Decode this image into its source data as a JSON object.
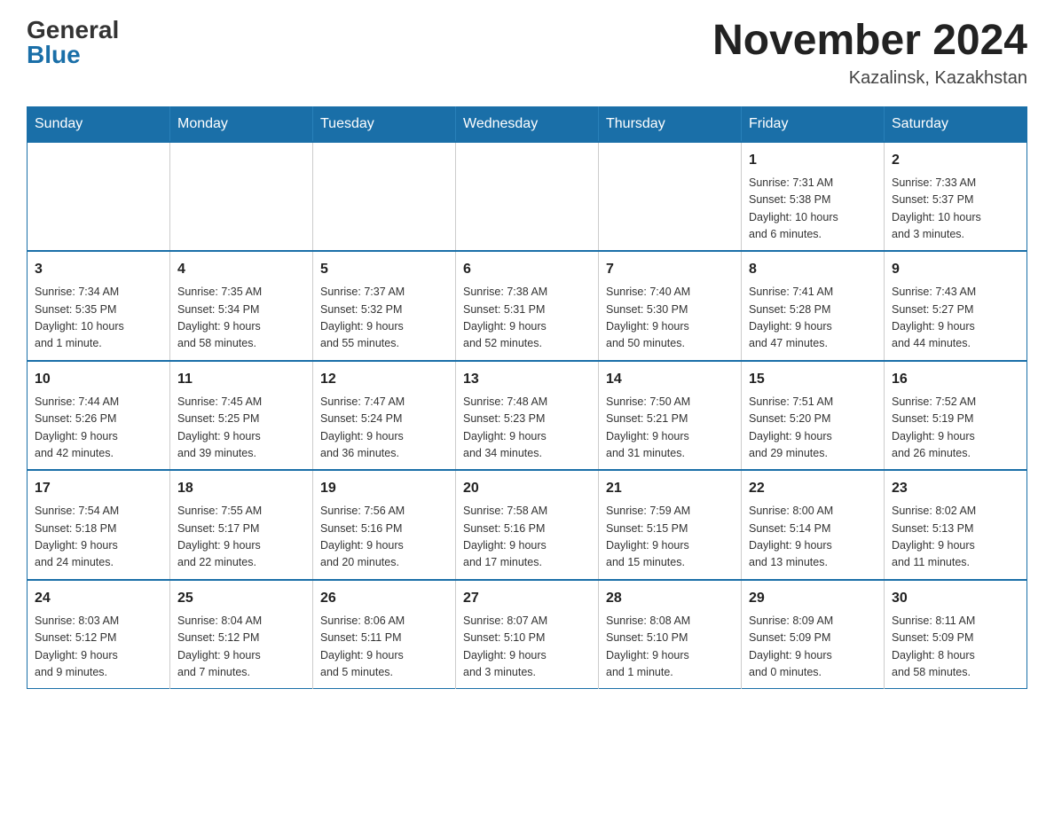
{
  "header": {
    "logo_general": "General",
    "logo_blue": "Blue",
    "month_title": "November 2024",
    "location": "Kazalinsk, Kazakhstan"
  },
  "weekdays": [
    "Sunday",
    "Monday",
    "Tuesday",
    "Wednesday",
    "Thursday",
    "Friday",
    "Saturday"
  ],
  "weeks": [
    [
      {
        "day": "",
        "info": ""
      },
      {
        "day": "",
        "info": ""
      },
      {
        "day": "",
        "info": ""
      },
      {
        "day": "",
        "info": ""
      },
      {
        "day": "",
        "info": ""
      },
      {
        "day": "1",
        "info": "Sunrise: 7:31 AM\nSunset: 5:38 PM\nDaylight: 10 hours\nand 6 minutes."
      },
      {
        "day": "2",
        "info": "Sunrise: 7:33 AM\nSunset: 5:37 PM\nDaylight: 10 hours\nand 3 minutes."
      }
    ],
    [
      {
        "day": "3",
        "info": "Sunrise: 7:34 AM\nSunset: 5:35 PM\nDaylight: 10 hours\nand 1 minute."
      },
      {
        "day": "4",
        "info": "Sunrise: 7:35 AM\nSunset: 5:34 PM\nDaylight: 9 hours\nand 58 minutes."
      },
      {
        "day": "5",
        "info": "Sunrise: 7:37 AM\nSunset: 5:32 PM\nDaylight: 9 hours\nand 55 minutes."
      },
      {
        "day": "6",
        "info": "Sunrise: 7:38 AM\nSunset: 5:31 PM\nDaylight: 9 hours\nand 52 minutes."
      },
      {
        "day": "7",
        "info": "Sunrise: 7:40 AM\nSunset: 5:30 PM\nDaylight: 9 hours\nand 50 minutes."
      },
      {
        "day": "8",
        "info": "Sunrise: 7:41 AM\nSunset: 5:28 PM\nDaylight: 9 hours\nand 47 minutes."
      },
      {
        "day": "9",
        "info": "Sunrise: 7:43 AM\nSunset: 5:27 PM\nDaylight: 9 hours\nand 44 minutes."
      }
    ],
    [
      {
        "day": "10",
        "info": "Sunrise: 7:44 AM\nSunset: 5:26 PM\nDaylight: 9 hours\nand 42 minutes."
      },
      {
        "day": "11",
        "info": "Sunrise: 7:45 AM\nSunset: 5:25 PM\nDaylight: 9 hours\nand 39 minutes."
      },
      {
        "day": "12",
        "info": "Sunrise: 7:47 AM\nSunset: 5:24 PM\nDaylight: 9 hours\nand 36 minutes."
      },
      {
        "day": "13",
        "info": "Sunrise: 7:48 AM\nSunset: 5:23 PM\nDaylight: 9 hours\nand 34 minutes."
      },
      {
        "day": "14",
        "info": "Sunrise: 7:50 AM\nSunset: 5:21 PM\nDaylight: 9 hours\nand 31 minutes."
      },
      {
        "day": "15",
        "info": "Sunrise: 7:51 AM\nSunset: 5:20 PM\nDaylight: 9 hours\nand 29 minutes."
      },
      {
        "day": "16",
        "info": "Sunrise: 7:52 AM\nSunset: 5:19 PM\nDaylight: 9 hours\nand 26 minutes."
      }
    ],
    [
      {
        "day": "17",
        "info": "Sunrise: 7:54 AM\nSunset: 5:18 PM\nDaylight: 9 hours\nand 24 minutes."
      },
      {
        "day": "18",
        "info": "Sunrise: 7:55 AM\nSunset: 5:17 PM\nDaylight: 9 hours\nand 22 minutes."
      },
      {
        "day": "19",
        "info": "Sunrise: 7:56 AM\nSunset: 5:16 PM\nDaylight: 9 hours\nand 20 minutes."
      },
      {
        "day": "20",
        "info": "Sunrise: 7:58 AM\nSunset: 5:16 PM\nDaylight: 9 hours\nand 17 minutes."
      },
      {
        "day": "21",
        "info": "Sunrise: 7:59 AM\nSunset: 5:15 PM\nDaylight: 9 hours\nand 15 minutes."
      },
      {
        "day": "22",
        "info": "Sunrise: 8:00 AM\nSunset: 5:14 PM\nDaylight: 9 hours\nand 13 minutes."
      },
      {
        "day": "23",
        "info": "Sunrise: 8:02 AM\nSunset: 5:13 PM\nDaylight: 9 hours\nand 11 minutes."
      }
    ],
    [
      {
        "day": "24",
        "info": "Sunrise: 8:03 AM\nSunset: 5:12 PM\nDaylight: 9 hours\nand 9 minutes."
      },
      {
        "day": "25",
        "info": "Sunrise: 8:04 AM\nSunset: 5:12 PM\nDaylight: 9 hours\nand 7 minutes."
      },
      {
        "day": "26",
        "info": "Sunrise: 8:06 AM\nSunset: 5:11 PM\nDaylight: 9 hours\nand 5 minutes."
      },
      {
        "day": "27",
        "info": "Sunrise: 8:07 AM\nSunset: 5:10 PM\nDaylight: 9 hours\nand 3 minutes."
      },
      {
        "day": "28",
        "info": "Sunrise: 8:08 AM\nSunset: 5:10 PM\nDaylight: 9 hours\nand 1 minute."
      },
      {
        "day": "29",
        "info": "Sunrise: 8:09 AM\nSunset: 5:09 PM\nDaylight: 9 hours\nand 0 minutes."
      },
      {
        "day": "30",
        "info": "Sunrise: 8:11 AM\nSunset: 5:09 PM\nDaylight: 8 hours\nand 58 minutes."
      }
    ]
  ]
}
